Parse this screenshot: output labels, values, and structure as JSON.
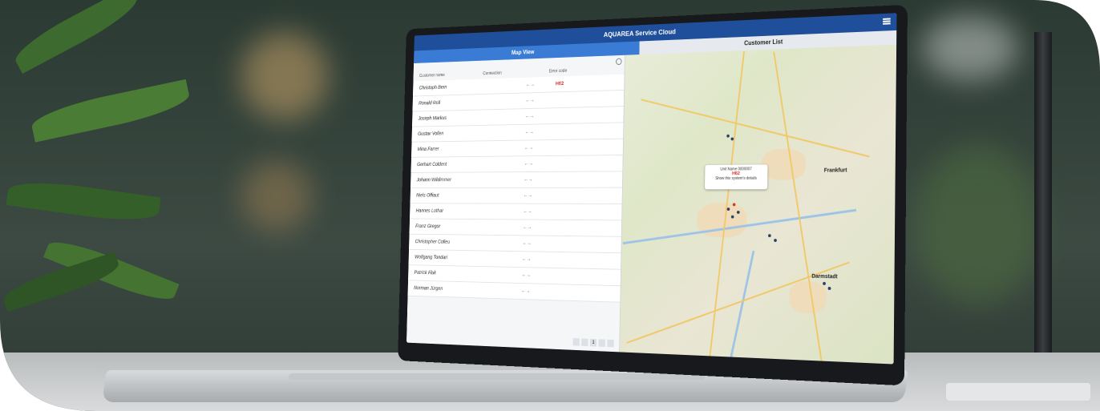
{
  "app": {
    "title": "AQUAREA Service Cloud",
    "tabs": [
      {
        "label": "Map View",
        "active": true
      },
      {
        "label": "Customer List",
        "active": false
      }
    ]
  },
  "list": {
    "columns": [
      "Customer name",
      "Connection",
      "Error code"
    ],
    "rows": [
      {
        "name": "Christoph Bern",
        "arrow": "←→",
        "tag": "H62"
      },
      {
        "name": "Ronald Roll",
        "arrow": "←→",
        "tag": ""
      },
      {
        "name": "Joseph Markus",
        "arrow": "←→",
        "tag": ""
      },
      {
        "name": "Gustav Vollen",
        "arrow": "←→",
        "tag": ""
      },
      {
        "name": "Mina Farrer",
        "arrow": "←→",
        "tag": ""
      },
      {
        "name": "Gerhart Coldent",
        "arrow": "←→",
        "tag": ""
      },
      {
        "name": "Johann Wildimmer",
        "arrow": "←→",
        "tag": ""
      },
      {
        "name": "Niels Offiaut",
        "arrow": "←→",
        "tag": ""
      },
      {
        "name": "Hannes Lothar",
        "arrow": "←→",
        "tag": ""
      },
      {
        "name": "Franz Gregor",
        "arrow": "←→",
        "tag": ""
      },
      {
        "name": "Christopher Colleu",
        "arrow": "←→",
        "tag": ""
      },
      {
        "name": "Wolfgang Tondari",
        "arrow": "←→",
        "tag": ""
      },
      {
        "name": "Patrick Fluk",
        "arrow": "←→",
        "tag": ""
      },
      {
        "name": "Norman Jürgen",
        "arrow": "←→",
        "tag": ""
      }
    ],
    "pager": [
      "1"
    ]
  },
  "map": {
    "labels": [
      "Frankfurt",
      "Darmstadt"
    ],
    "popup": {
      "title": "Unit Name 0000007",
      "tag": "H62",
      "line": "Show this system's details"
    }
  },
  "colors": {
    "header": "#1f4f9b",
    "active_tab": "#3a7bd5",
    "error": "#d0342c"
  }
}
